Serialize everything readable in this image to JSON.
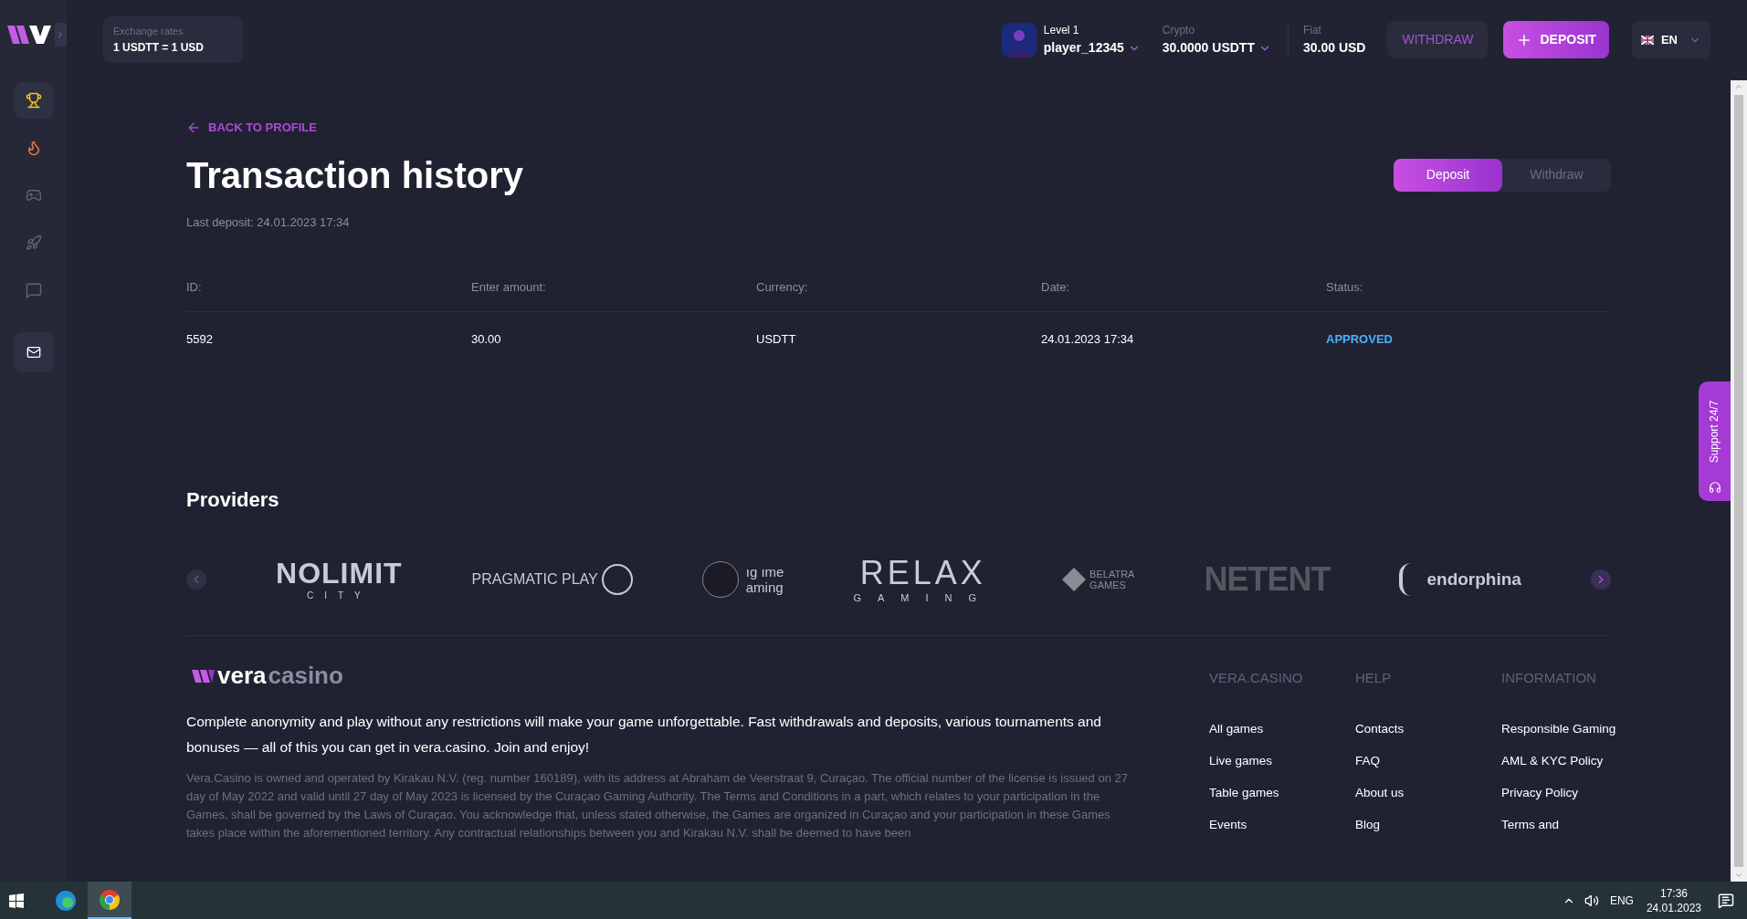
{
  "header": {
    "exchange": {
      "label": "Exchange rates",
      "value": "1 USDTT = 1 USD"
    },
    "user": {
      "level": "Level 1",
      "name": "player_12345"
    },
    "crypto": {
      "label": "Crypto",
      "value": "30.0000 USDTT"
    },
    "fiat": {
      "label": "Fiat",
      "value": "30.00 USD"
    },
    "withdraw_button": "WITHDRAW",
    "deposit_button": "DEPOSIT",
    "language": "EN"
  },
  "sidebar": {
    "items": [
      {
        "kind": "trophy",
        "selected": true
      },
      {
        "kind": "fire",
        "selected": false
      },
      {
        "kind": "slot",
        "selected": false
      },
      {
        "kind": "rocket",
        "selected": false
      },
      {
        "kind": "chat",
        "selected": false
      }
    ]
  },
  "back_link": "BACK TO PROFILE",
  "title": "Transaction history",
  "last_deposit": "Last deposit: 24.01.2023 17:34",
  "tabs": [
    {
      "label": "Deposit",
      "selected": true
    },
    {
      "label": "Withdraw",
      "selected": false
    }
  ],
  "table": {
    "columns": [
      "ID:",
      "Enter amount:",
      "Currency:",
      "Date:",
      "Status:"
    ],
    "rows": [
      {
        "cells": [
          "5592",
          "30.00",
          "USDTT",
          "24.01.2023 17:34"
        ],
        "status": "APPROVED",
        "kind": "approved"
      }
    ]
  },
  "providers": {
    "title": "Providers",
    "logos": [
      {
        "kind": "nolimit",
        "name": "NOLIMIT",
        "sub": "CITY"
      },
      {
        "kind": "pragmatic",
        "name": "PRAGMATIC PLAY"
      },
      {
        "kind": "cut",
        "name": "ıg ıme",
        "sub": "aming"
      },
      {
        "kind": "relax",
        "name": "RELAX",
        "sub": "GAMING"
      },
      {
        "kind": "belatra",
        "name": "BELATRA",
        "sub": "GAMES"
      },
      {
        "kind": "netent",
        "name": "NETENT"
      },
      {
        "kind": "endorphina",
        "name": "endorphina"
      }
    ]
  },
  "footer": {
    "logo": {
      "first": "vera",
      "second": "casino"
    },
    "intro": "Complete anonymity and play without any restrictions will make your game unforgettable. Fast withdrawals and deposits, various tournaments and bonuses — all of this you can get in vera.casino. Join and enjoy!",
    "legal": "Vera.Casino is owned and operated by Kirakau N.V. (reg. number 160189), with its address at Abraham de Veerstraat 9, Curaçao. The official number of the license is issued on 27 day of May 2022 and valid until 27 day of May 2023 is licensed by the Curaçao Gaming Authority. The Terms and Conditions in a part, which relates to your participation in the Games, shall be governed by the Laws of Curaçao. You acknowledge that, unless stated otherwise, the Games are organized in Curaçao and your participation in these Games takes place within the aforementioned territory. Any contractual relationships between you and Kirakau N.V. shall be deemed to have been",
    "columns": [
      {
        "title": "VERA.CASINO",
        "links": [
          "All games",
          "Live games",
          "Table games",
          "Events"
        ]
      },
      {
        "title": "HELP",
        "links": [
          "Contacts",
          "FAQ",
          "About us",
          "Blog"
        ]
      },
      {
        "title": "INFORMATION",
        "links": [
          "Responsible Gaming",
          "AML & KYC Policy",
          "Privacy Policy",
          "Terms and"
        ]
      }
    ]
  },
  "support_tab": "Support 24/7",
  "taskbar": {
    "apps": [
      {
        "kind": "edge",
        "selected": false
      },
      {
        "kind": "chrome",
        "selected": true
      }
    ],
    "language": "ENG",
    "time": "17:36",
    "date": "24.01.2023"
  }
}
